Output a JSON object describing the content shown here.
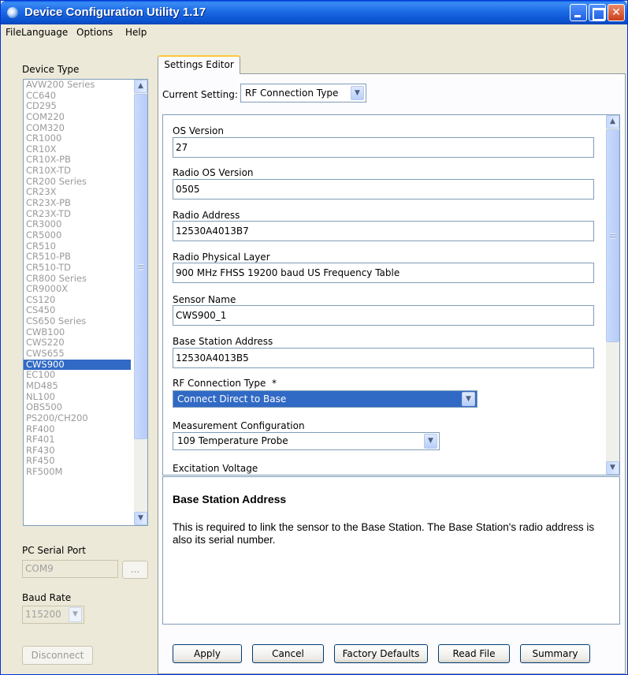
{
  "window": {
    "title": "Device Configuration Utility 1.17"
  },
  "menu": {
    "file": "File",
    "language": "Language",
    "options": "Options",
    "help": "Help"
  },
  "left": {
    "device_type_label": "Device Type",
    "devices": [
      "AVW200 Series",
      "CC640",
      "CD295",
      "COM220",
      "COM320",
      "CR1000",
      "CR10X",
      "CR10X-PB",
      "CR10X-TD",
      "CR200 Series",
      "CR23X",
      "CR23X-PB",
      "CR23X-TD",
      "CR3000",
      "CR5000",
      "CR510",
      "CR510-PB",
      "CR510-TD",
      "CR800 Series",
      "CR9000X",
      "CS120",
      "CS450",
      "CS650 Series",
      "CWB100",
      "CWS220",
      "CWS655",
      "CWS900",
      "EC100",
      "MD485",
      "NL100",
      "OBS500",
      "PS200/CH200",
      "RF400",
      "RF401",
      "RF430",
      "RF450",
      "RF500M"
    ],
    "selected_device": "CWS900",
    "serial_port_label": "PC Serial Port",
    "serial_port_value": "COM9",
    "browse_label": "...",
    "baud_rate_label": "Baud Rate",
    "baud_rate_value": "115200",
    "disconnect_label": "Disconnect"
  },
  "tab": {
    "label": "Settings Editor"
  },
  "current_setting": {
    "label": "Current Setting:",
    "value": "RF Connection Type"
  },
  "fields": {
    "os_version": {
      "label": "OS Version",
      "value": "27"
    },
    "radio_os_version": {
      "label": "Radio OS Version",
      "value": "0505"
    },
    "radio_address": {
      "label": "Radio Address",
      "value": "12530A4013B7"
    },
    "radio_physical_layer": {
      "label": "Radio Physical Layer",
      "value": "900 MHz FHSS 19200 baud US Frequency Table"
    },
    "sensor_name": {
      "label": "Sensor Name",
      "value": "CWS900_1"
    },
    "base_station_address": {
      "label": "Base Station Address",
      "value": "12530A4013B5"
    },
    "rf_connection_type": {
      "label": "RF Connection Type  *",
      "value": "Connect Direct to Base"
    },
    "measurement_configuration": {
      "label": "Measurement Configuration",
      "value": "109 Temperature Probe"
    },
    "excitation_voltage": {
      "label": "Excitation Voltage"
    }
  },
  "help": {
    "title": "Base Station Address",
    "text": "This is required to link the sensor to the Base Station. The Base Station's radio address is also its serial number."
  },
  "buttons": {
    "apply": "Apply",
    "cancel": "Cancel",
    "factory_defaults": "Factory Defaults",
    "read_file": "Read File",
    "summary": "Summary"
  },
  "colors": {
    "selection": "#316ac5",
    "titlebar": "#0b52d0",
    "face": "#ece9d8"
  }
}
